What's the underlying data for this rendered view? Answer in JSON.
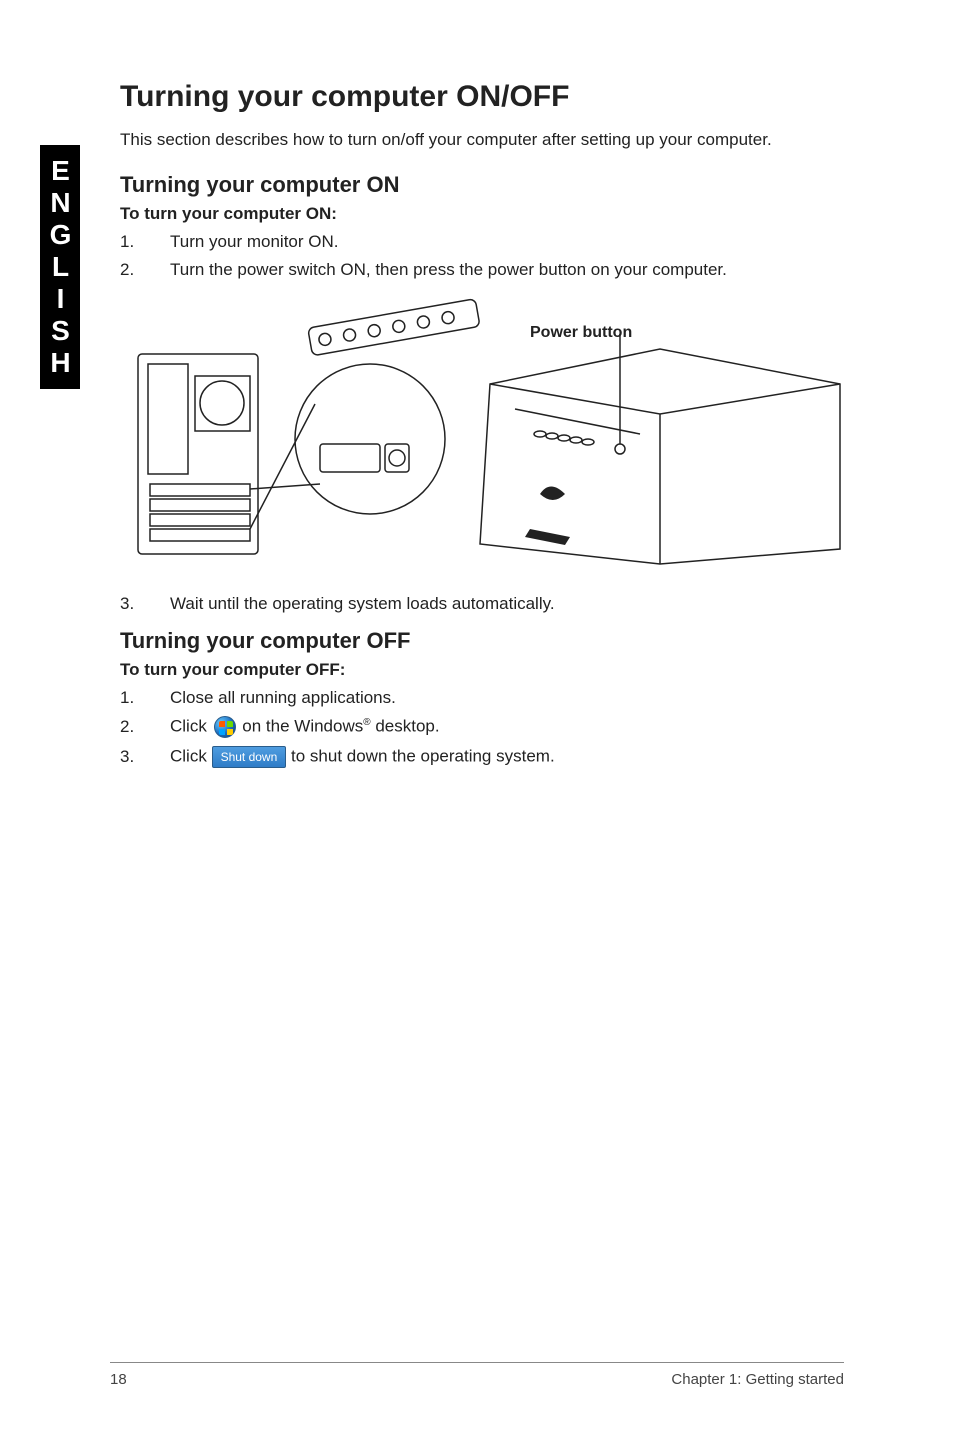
{
  "side_tab": "ENGLISH",
  "title": "Turning your computer ON/OFF",
  "intro": "This section describes how to turn on/off your computer after setting up your computer.",
  "section_on": {
    "heading": "Turning your computer ON",
    "lead": "To turn your computer ON:",
    "steps": [
      {
        "n": "1.",
        "text": "Turn your monitor ON."
      },
      {
        "n": "2.",
        "text": "Turn the power switch ON, then press the power button on your computer."
      },
      {
        "n": "3.",
        "text": "Wait until the operating system loads automatically."
      }
    ]
  },
  "figure": {
    "power_button_label": "Power button"
  },
  "section_off": {
    "heading": "Turning your computer OFF",
    "lead": "To turn your computer OFF:",
    "steps": [
      {
        "n": "1.",
        "text": "Close all running applications."
      },
      {
        "n": "2.",
        "pre": "Click ",
        "post_a": " on the Windows",
        "post_b": " desktop."
      },
      {
        "n": "3.",
        "pre": "Click ",
        "btn": "Shut down",
        "post": " to shut down the operating system."
      }
    ]
  },
  "footer": {
    "page": "18",
    "chapter": "Chapter 1: Getting started"
  }
}
